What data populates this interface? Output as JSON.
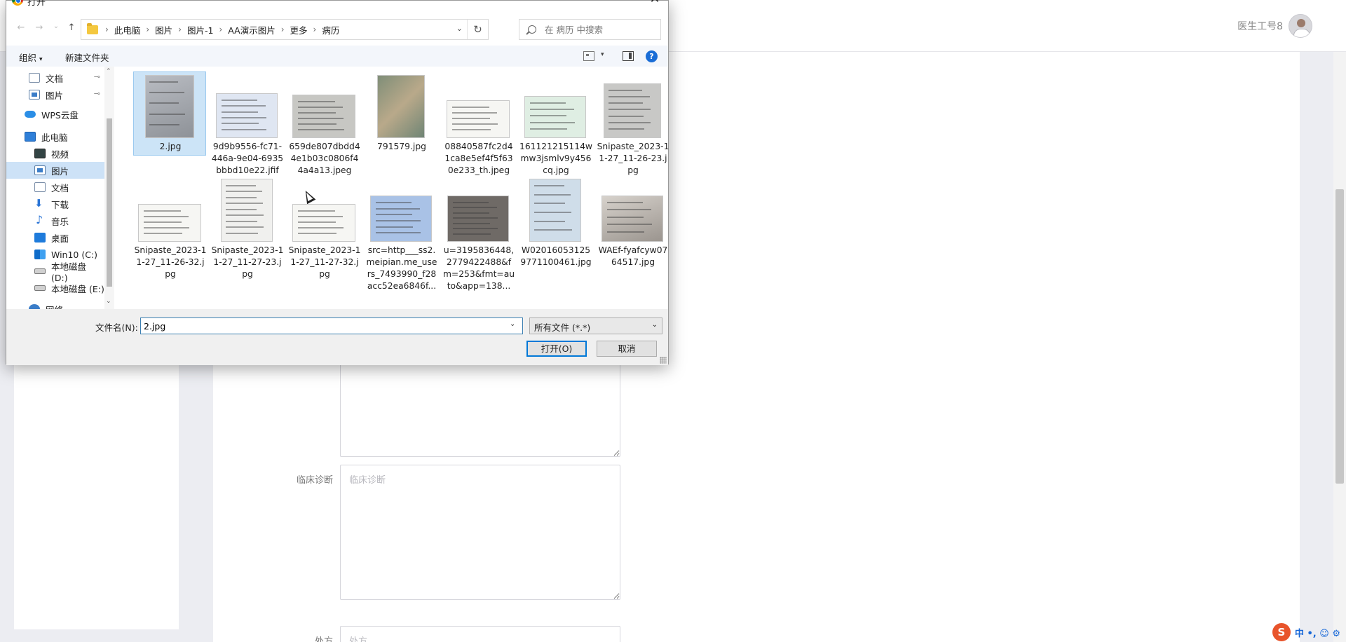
{
  "web": {
    "user_name": "医生工号8",
    "fields": [
      {
        "label": "",
        "placeholder": ""
      },
      {
        "label": "临床诊断",
        "placeholder": "临床诊断"
      },
      {
        "label": "处方",
        "placeholder": "处方"
      }
    ],
    "ime": {
      "logo": "S",
      "text": "中 •, ☺ ⚙"
    }
  },
  "dialog": {
    "title": "打开",
    "close": "✕",
    "nav": {
      "back": "←",
      "forward": "→",
      "recent": "⌄",
      "up": "↑"
    },
    "breadcrumbs": [
      "此电脑",
      "图片",
      "图片-1",
      "AA演示图片",
      "更多",
      "病历"
    ],
    "breadcrumb_sep": "›",
    "address_dropdown": "⌄",
    "refresh": "↻",
    "search_placeholder": "在 病历 中搜索",
    "toolbar": {
      "organize": "组织",
      "organize_caret": "▾",
      "new_folder": "新建文件夹",
      "view_caret": "▾",
      "help": "?"
    },
    "sidebar": {
      "scroll_up": "⌃",
      "scroll_down": "⌄",
      "items": [
        {
          "label": "文档",
          "icon": "document-icon",
          "pinned": true
        },
        {
          "label": "图片",
          "icon": "pictures-icon",
          "pinned": true
        },
        {
          "label": "WPS云盘",
          "icon": "cloud-icon",
          "pinned": false
        },
        {
          "label": "此电脑",
          "icon": "computer-icon",
          "pinned": false
        },
        {
          "label": "视频",
          "icon": "video-icon",
          "pinned": false
        },
        {
          "label": "图片",
          "icon": "pictures-icon",
          "pinned": false,
          "selected": true
        },
        {
          "label": "文档",
          "icon": "document-icon",
          "pinned": false
        },
        {
          "label": "下载",
          "icon": "download-icon",
          "pinned": false
        },
        {
          "label": "音乐",
          "icon": "music-icon",
          "pinned": false
        },
        {
          "label": "桌面",
          "icon": "desktop-icon",
          "pinned": false
        },
        {
          "label": "Win10 (C:)",
          "icon": "windows-drive-icon",
          "pinned": false
        },
        {
          "label": "本地磁盘 (D:)",
          "icon": "disk-icon",
          "pinned": false
        },
        {
          "label": "本地磁盘 (E:)",
          "icon": "disk-icon",
          "pinned": false
        },
        {
          "label": "网络",
          "icon": "network-icon",
          "pinned": false
        }
      ],
      "pin_glyph": "📌"
    },
    "files": [
      {
        "name": "2.jpg",
        "thumb": "gray-scan",
        "selected": true
      },
      {
        "name": "9d9b9556-fc71-446a-9e04-6935bbbd10e22.jfif",
        "thumb": "blue-doc"
      },
      {
        "name": "659de807dbdd44e1b03c0806f44a4a13.jpeg",
        "thumb": "gray-form"
      },
      {
        "name": "791579.jpg",
        "thumb": "map"
      },
      {
        "name": "08840587fc2d41ca8e5ef4f5f630e233_th.jpeg",
        "thumb": "white-text"
      },
      {
        "name": "161121215114wmw3jsmlv9y456cq.jpg",
        "thumb": "green-note"
      },
      {
        "name": "Snipaste_2023-11-27_11-26-23.jpg",
        "thumb": "table-scan"
      },
      {
        "name": "Snipaste_2023-11-27_11-26-32.jpg",
        "thumb": "white-text"
      },
      {
        "name": "Snipaste_2023-11-27_11-27-23.jpg",
        "thumb": "white-page"
      },
      {
        "name": "Snipaste_2023-11-27_11-27-32.jpg",
        "thumb": "white-text"
      },
      {
        "name": "src=http___ss2.meipian.me_users_7493990_f28acc52ea6846f...",
        "thumb": "blue-note"
      },
      {
        "name": "u=3195836448,2779422488&fm=253&fmt=auto&app=138...",
        "thumb": "dark-table"
      },
      {
        "name": "W020160531259771100461.jpg",
        "thumb": "blue-form"
      },
      {
        "name": "WAEf-fyafcyw0764517.jpg",
        "thumb": "photo-paper"
      }
    ],
    "filename_label": "文件名(N):",
    "filename_value": "2.jpg",
    "filetype": "所有文件 (*.*)",
    "open_button": "打开(O)",
    "cancel_button": "取消"
  },
  "colors": {
    "accent": "#0078d7",
    "selection": "#cce4f7",
    "nav_selected": "#cde2f7"
  }
}
